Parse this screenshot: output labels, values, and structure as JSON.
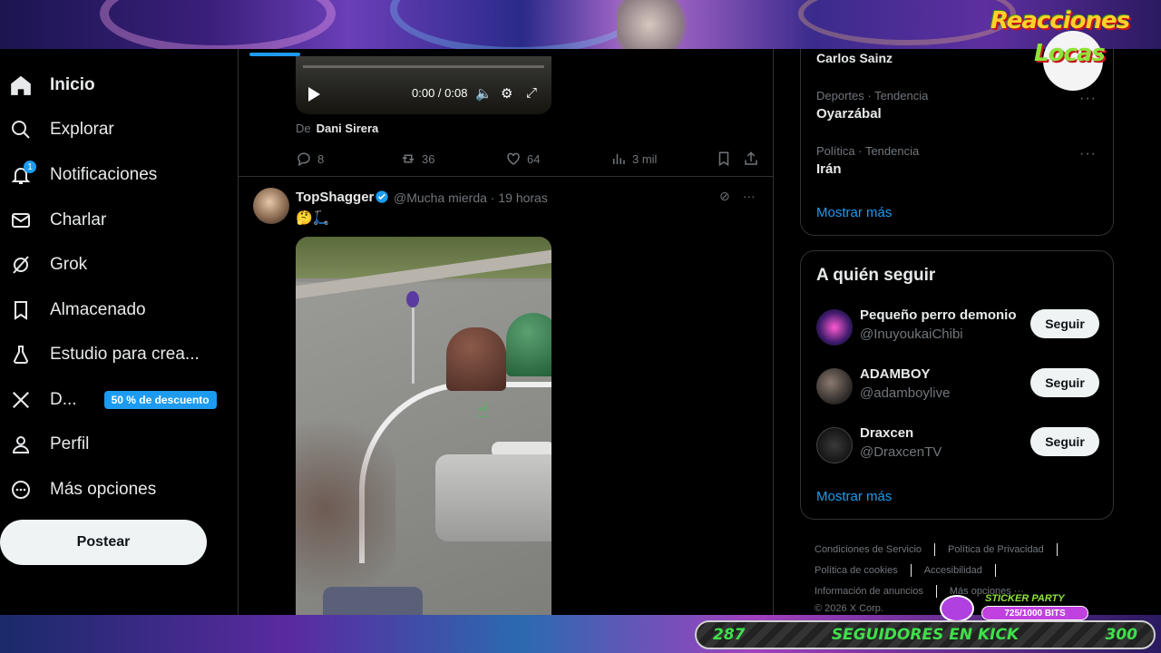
{
  "nav": {
    "items": [
      {
        "label": "Inicio",
        "icon": "home-icon"
      },
      {
        "label": "Explorar",
        "icon": "search-icon"
      },
      {
        "label": "Notificaciones",
        "icon": "bell-icon",
        "badge": "1"
      },
      {
        "label": "Charlar",
        "icon": "mail-icon"
      },
      {
        "label": "Grok",
        "icon": "grok-icon"
      },
      {
        "label": "Almacenado",
        "icon": "bookmark-icon"
      },
      {
        "label": "Estudio para crea...",
        "icon": "flask-icon"
      },
      {
        "label": "D...",
        "icon": "x-logo-icon",
        "promo": "50 % de descuento"
      },
      {
        "label": "Perfil",
        "icon": "person-icon"
      },
      {
        "label": "Más opciones",
        "icon": "more-circle-icon"
      }
    ],
    "post_label": "Postear"
  },
  "tweet1": {
    "video_time": "0:00 / 0:08",
    "from_label": "De",
    "from_name": "Dani Sirera",
    "replies": "8",
    "reposts": "36",
    "likes": "64",
    "views": "3 mil"
  },
  "tweet2": {
    "name": "TopShagger",
    "handle": "@Mucha mierda · 19 horas",
    "text": "🤔🛴"
  },
  "trends": {
    "top_name": "Carlos Sainz",
    "items": [
      {
        "category": "Deportes · Tendencia",
        "name": "Oyarzábal"
      },
      {
        "category": "Política · Tendencia",
        "name": "Irán"
      }
    ],
    "show_more": "Mostrar más"
  },
  "who_to_follow": {
    "title": "A quién seguir",
    "users": [
      {
        "name": "Pequeño perro demonio",
        "handle": "@InuyoukaiChibi",
        "button": "Seguir"
      },
      {
        "name": "ADAMBOY",
        "handle": "@adamboylive",
        "button": "Seguir"
      },
      {
        "name": "Draxcen",
        "handle": "@DraxcenTV",
        "button": "Seguir"
      }
    ],
    "show_more": "Mostrar más"
  },
  "footer": {
    "links": [
      "Condiciones de Servicio",
      "Política de Privacidad",
      "Política de cookies",
      "Accesibilidad",
      "Información de anuncios",
      "Más opciones ···"
    ],
    "copyright": "© 2026 X Corp."
  },
  "overlay": {
    "logo_line1": "Reacciones",
    "logo_line2": "Locas",
    "sticker_title": "STICKER PARTY",
    "sticker_bits": "725/1000 BITS",
    "kick_start": "287",
    "kick_label": "SEGUIDORES EN KICK",
    "kick_goal": "300"
  },
  "colors": {
    "accent": "#1d9bf0",
    "background": "#000000",
    "kick_green": "#3fe04a"
  }
}
